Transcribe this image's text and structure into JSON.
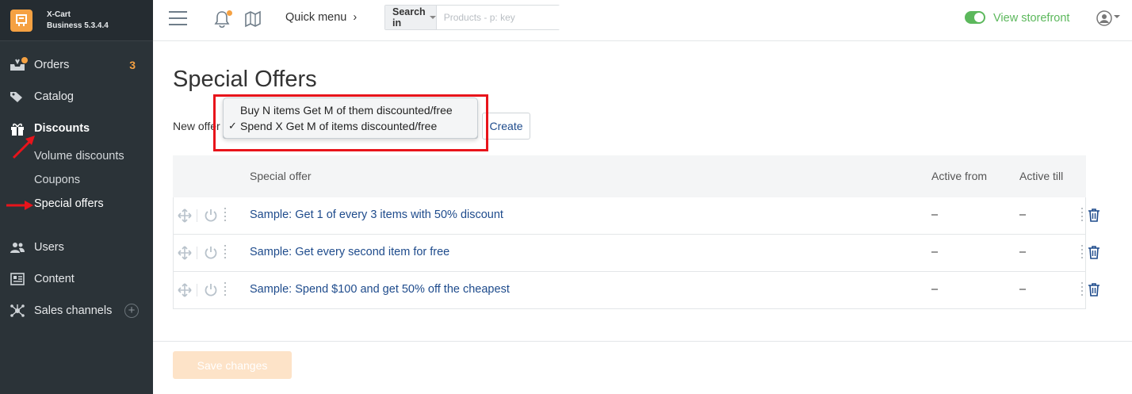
{
  "brand": {
    "name": "X-Cart",
    "edition": "Business 5.3.4.4"
  },
  "sidebar": {
    "items": [
      {
        "label": "Orders",
        "badge": "3",
        "icon": "orders-icon"
      },
      {
        "label": "Catalog",
        "icon": "tag-icon"
      },
      {
        "label": "Discounts",
        "icon": "gift-icon",
        "active": true,
        "children": [
          {
            "label": "Volume discounts"
          },
          {
            "label": "Coupons"
          },
          {
            "label": "Special offers",
            "current": true
          }
        ]
      },
      {
        "label": "Users",
        "icon": "users-icon"
      },
      {
        "label": "Content",
        "icon": "content-icon"
      },
      {
        "label": "Sales channels",
        "icon": "network-icon"
      }
    ]
  },
  "topbar": {
    "quick_menu": "Quick menu",
    "search_in": "Search in",
    "search_placeholder": "Products - p: key",
    "view_storefront": "View storefront"
  },
  "main": {
    "title": "Special Offers",
    "new_offer_label": "New offer",
    "create_label": "Create",
    "dropdown_options": [
      {
        "label": "Buy N items Get M of them discounted/free",
        "selected": false
      },
      {
        "label": "Spend X Get M of items discounted/free",
        "selected": true
      }
    ],
    "table": {
      "headers": {
        "offer": "Special offer",
        "from": "Active from",
        "till": "Active till"
      },
      "rows": [
        {
          "offer": "Sample: Get 1 of every 3 items with 50% discount",
          "from": "–",
          "till": "–"
        },
        {
          "offer": "Sample: Get every second item for free",
          "from": "–",
          "till": "–"
        },
        {
          "offer": "Sample: Spend $100 and get 50% off the cheapest",
          "from": "–",
          "till": "–"
        }
      ]
    },
    "save_label": "Save changes"
  },
  "colors": {
    "sidebar_bg": "#2b3338",
    "accent_orange": "#f5a142",
    "link_blue": "#1e4b8c",
    "green": "#5cb85c",
    "annotation_red": "#e8141b"
  }
}
